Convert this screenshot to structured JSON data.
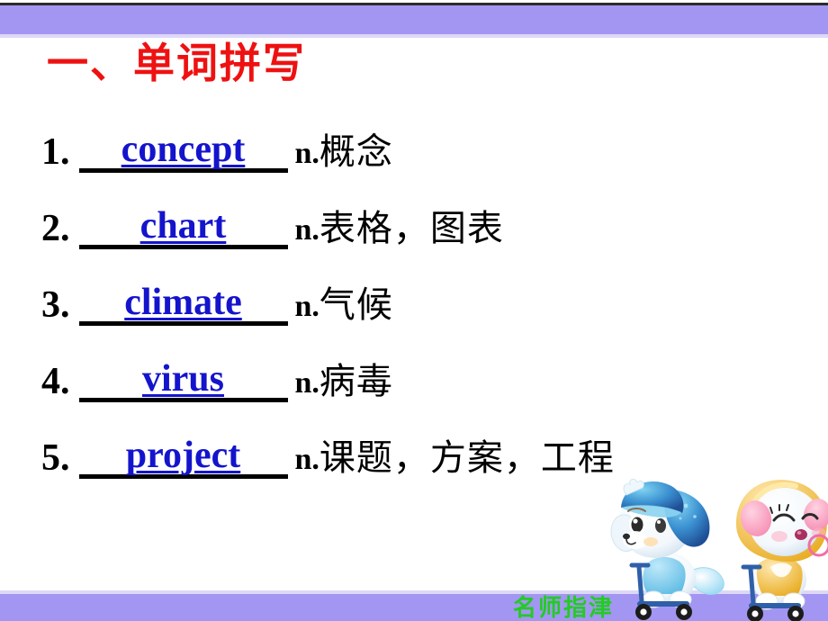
{
  "slide": {
    "title": "一、单词拼写",
    "title_color": "#ee1111",
    "band_color": "#a396f2",
    "blank_word_color": "#1414cd",
    "footer_text": "名师指津",
    "footer_color": "#22cc22"
  },
  "words": [
    {
      "num": "1.",
      "word": "concept",
      "pos": "n.",
      "meaning": "概念"
    },
    {
      "num": "2.",
      "word": "chart",
      "pos": "n.",
      "meaning": "表格，图表"
    },
    {
      "num": "3.",
      "word": "climate",
      "pos": "n.",
      "meaning": "气候"
    },
    {
      "num": "4.",
      "word": "virus",
      "pos": "n.",
      "meaning": "病毒"
    },
    {
      "num": "5.",
      "word": "project",
      "pos": "n.",
      "meaning": "课题，方案，工程"
    }
  ],
  "mascots": [
    {
      "name": "blue-cap-puppy-on-scooter"
    },
    {
      "name": "yellow-hood-kitten-on-scooter"
    }
  ]
}
